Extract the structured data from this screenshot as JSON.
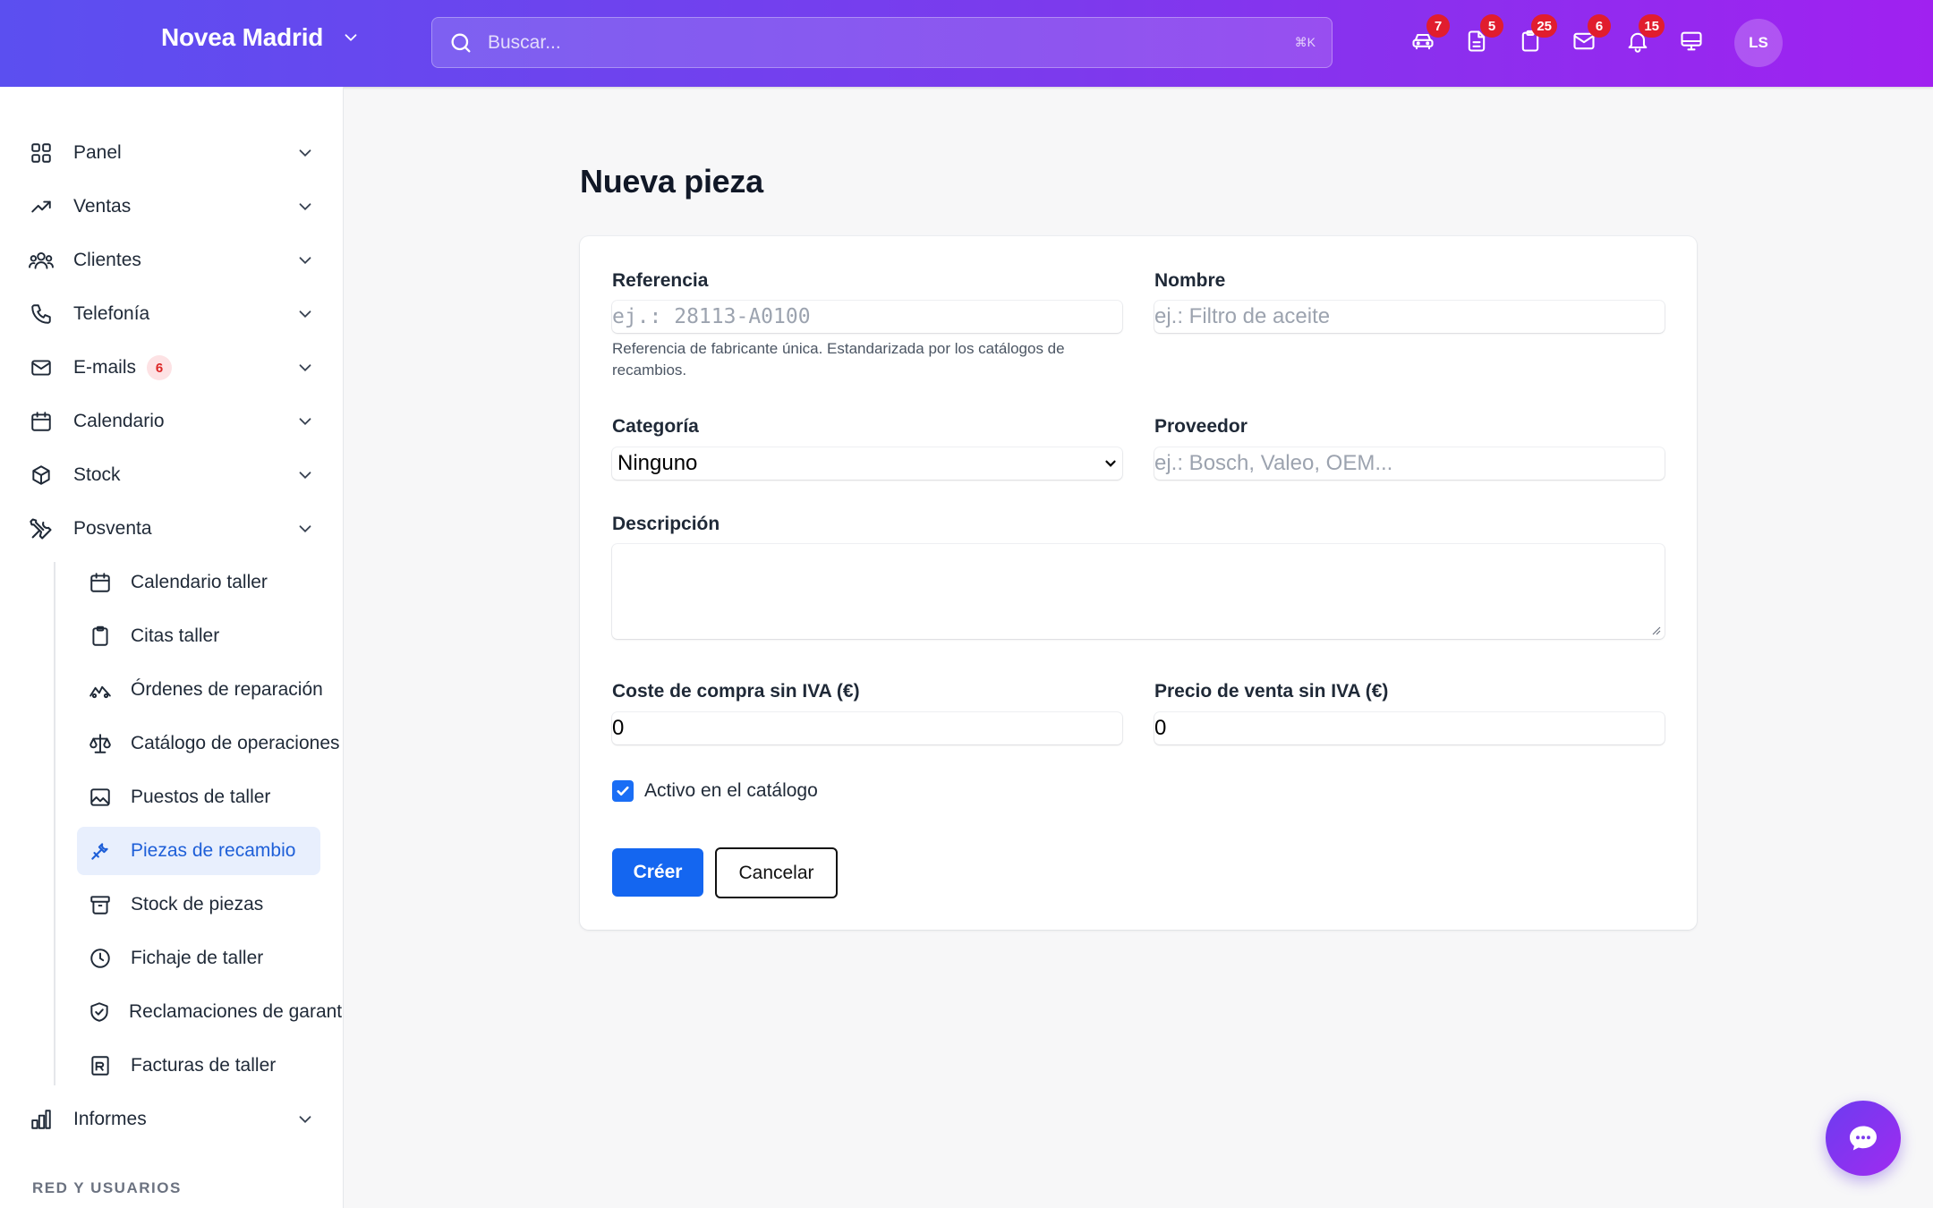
{
  "header": {
    "brand": "Novea Madrid",
    "search_placeholder": "Buscar...",
    "search_shortcut": "⌘K",
    "icons": [
      {
        "name": "car-icon",
        "badge": "7"
      },
      {
        "name": "document-icon",
        "badge": "5"
      },
      {
        "name": "clipboard-icon",
        "badge": "25"
      },
      {
        "name": "mail-icon",
        "badge": "6"
      },
      {
        "name": "bell-icon",
        "badge": "15"
      },
      {
        "name": "monitor-icon",
        "badge": ""
      }
    ],
    "avatar_initials": "LS"
  },
  "sidebar": {
    "items": [
      {
        "label": "Panel",
        "icon": "grid-icon"
      },
      {
        "label": "Ventas",
        "icon": "trending-up-icon"
      },
      {
        "label": "Clientes",
        "icon": "users-icon"
      },
      {
        "label": "Telefonía",
        "icon": "phone-icon"
      },
      {
        "label": "E-mails",
        "icon": "mail-icon",
        "badge": "6"
      },
      {
        "label": "Calendario",
        "icon": "calendar-icon"
      },
      {
        "label": "Stock",
        "icon": "box-icon"
      },
      {
        "label": "Posventa",
        "icon": "tools-icon"
      }
    ],
    "posventa_items": [
      {
        "label": "Calendario taller",
        "icon": "calendar-icon"
      },
      {
        "label": "Citas taller",
        "icon": "clipboard-icon"
      },
      {
        "label": "Órdenes de reparación",
        "icon": "car-front-icon"
      },
      {
        "label": "Catálogo de operaciones",
        "icon": "scale-icon"
      },
      {
        "label": "Puestos de taller",
        "icon": "image-icon"
      },
      {
        "label": "Piezas de recambio",
        "icon": "wrench-icon",
        "active": true
      },
      {
        "label": "Stock de piezas",
        "icon": "archive-icon"
      },
      {
        "label": "Fichaje de taller",
        "icon": "clock-icon"
      },
      {
        "label": "Reclamaciones de garantía",
        "icon": "shield-check-icon"
      },
      {
        "label": "Facturas de taller",
        "icon": "invoice-icon"
      }
    ],
    "after_items": [
      {
        "label": "Informes",
        "icon": "bar-chart-icon"
      }
    ],
    "section_label": "RED Y USUARIOS"
  },
  "page": {
    "title": "Nueva pieza"
  },
  "form": {
    "referencia_label": "Referencia",
    "referencia_placeholder": "ej.: 28113-A0100",
    "referencia_help": "Referencia de fabricante única. Estandarizada por los catálogos de recambios.",
    "nombre_label": "Nombre",
    "nombre_placeholder": "ej.: Filtro de aceite",
    "categoria_label": "Categoría",
    "categoria_value": "Ninguno",
    "proveedor_label": "Proveedor",
    "proveedor_placeholder": "ej.: Bosch, Valeo, OEM...",
    "descripcion_label": "Descripción",
    "descripcion_value": "",
    "coste_label": "Coste de compra sin IVA (€)",
    "coste_value": "0",
    "precio_label": "Precio de venta sin IVA (€)",
    "precio_value": "0",
    "activo_label": "Activo en el catálogo",
    "activo_checked": true,
    "submit_label": "Créer",
    "cancel_label": "Cancelar"
  },
  "colors": {
    "header_gradient_start": "#5b4ff0",
    "header_gradient_end": "#a021f0",
    "primary": "#1466f0",
    "badge_red": "#e11d2e",
    "active_bg": "#e8effd"
  }
}
